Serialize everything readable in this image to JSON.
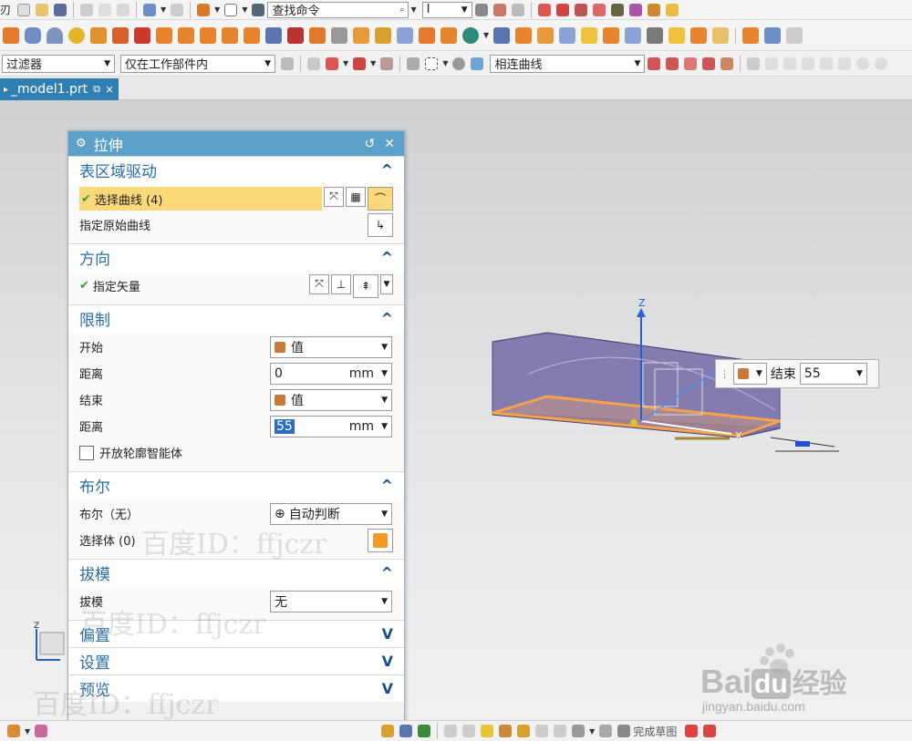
{
  "toolbar1": {
    "command_search_placeholder": "查找命令",
    "left_label": "刃",
    "selector_value": "I"
  },
  "filter_bar": {
    "filter_label": "过滤器",
    "scope_value": "仅在工作部件内",
    "curve_rule_value": "相连曲线"
  },
  "tab": {
    "filename": "_model1.prt",
    "pin": "⧉",
    "close": "×"
  },
  "dialog": {
    "title": "拉伸",
    "sections": {
      "section_curve": {
        "title": "表区域驱动",
        "select_curve": "选择曲线 (4)",
        "spec_origin": "指定原始曲线"
      },
      "direction": {
        "title": "方向",
        "spec_vector": "指定矢量"
      },
      "limits": {
        "title": "限制",
        "start_label": "开始",
        "start_value": "值",
        "dist1_label": "距离",
        "dist1_value": "0",
        "unit1": "mm",
        "end_label": "结束",
        "end_value": "值",
        "dist2_label": "距离",
        "dist2_value": "55",
        "unit2": "mm",
        "open_profile": "开放轮廓智能体"
      },
      "boolean": {
        "title": "布尔",
        "bool_label": "布尔（无）",
        "bool_value": "自动判断",
        "select_body": "选择体 (0)"
      },
      "draft": {
        "title": "拔模",
        "draft_label": "拔模",
        "draft_value": "无"
      },
      "offset": {
        "title": "偏置"
      },
      "settings": {
        "title": "设置"
      },
      "preview": {
        "title": "预览"
      }
    }
  },
  "floating_edit": {
    "label": "结束",
    "value": "55"
  },
  "watermarks": [
    "百度ID：ffjczr",
    "百度ID：ffjczr",
    "百度ID：ffjczr"
  ],
  "baidu_logo": {
    "brand_main": "Bai",
    "brand_du": "du",
    "brand_cn": "经验",
    "url": "jingyan.baidu.com"
  },
  "bottom_bar": {
    "finish_sketch": "完成草图"
  },
  "colors": {
    "accent": "#5aa0c8",
    "highlight": "#fbd97a",
    "solid": "#7c72a6",
    "edge": "#f4a24c"
  }
}
